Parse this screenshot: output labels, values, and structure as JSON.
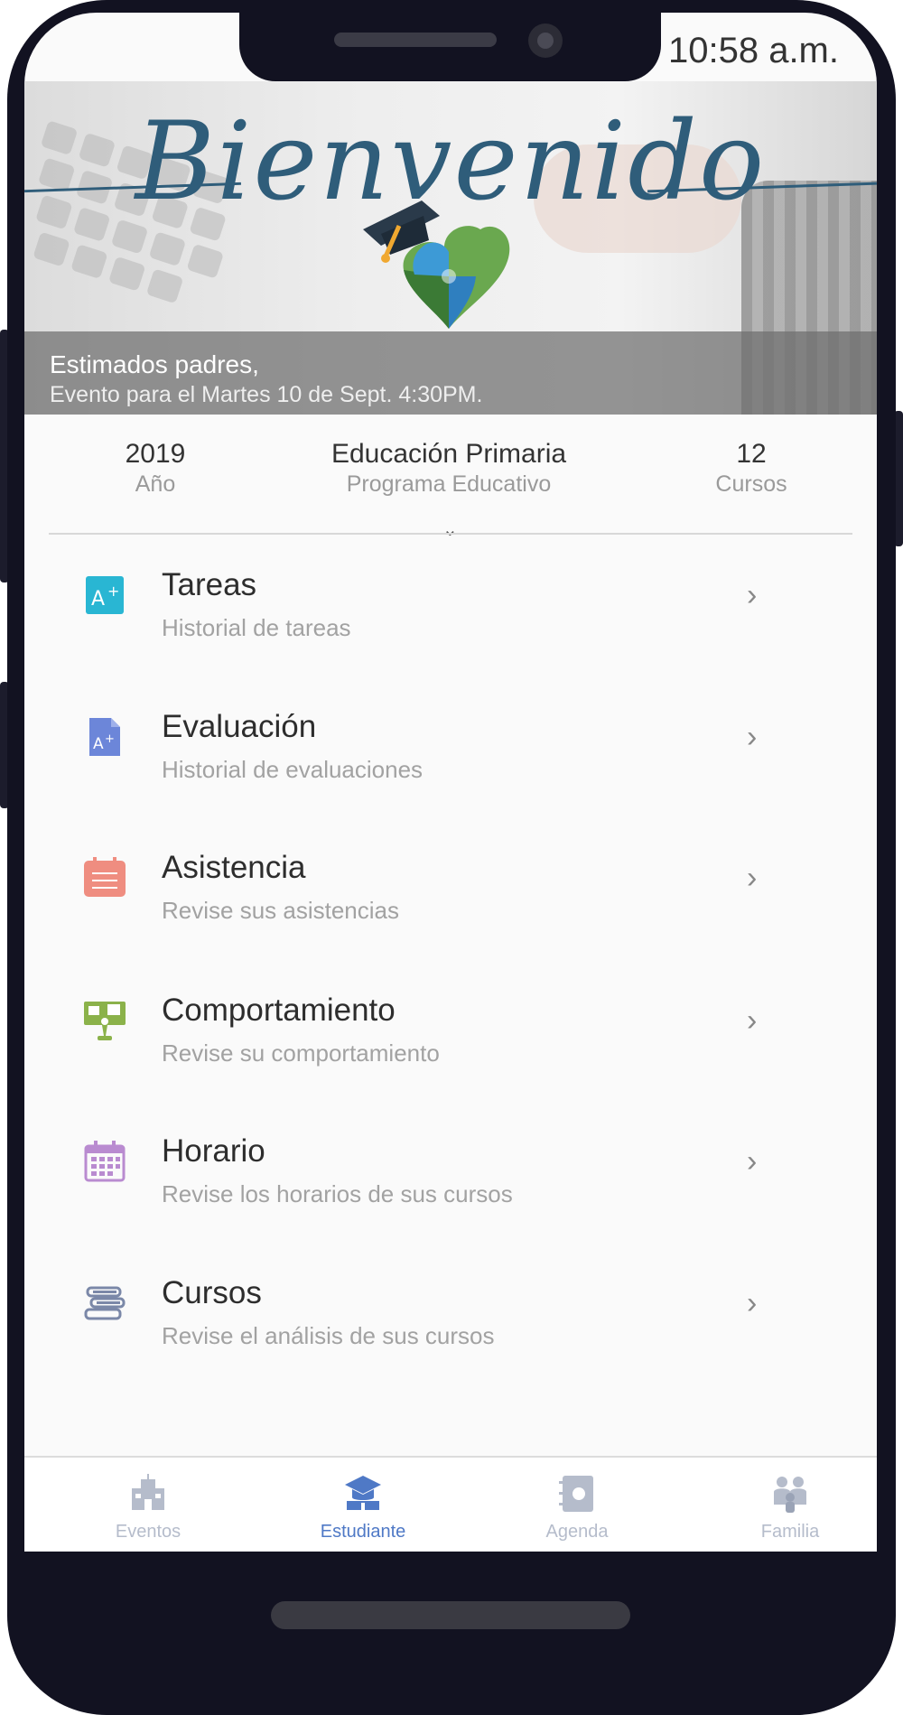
{
  "status_bar": {
    "time": "10:58 a.m."
  },
  "banner": {
    "welcome_text": "Bienvenido",
    "title": "Estimados padres,",
    "subtitle": "Evento para el Martes 10 de Sept. 4:30PM."
  },
  "stats": {
    "year": {
      "value": "2019",
      "label": "Año"
    },
    "program": {
      "value": "Educación Primaria",
      "label": "Programa Educativo"
    },
    "courses": {
      "value": "12",
      "label": "Cursos"
    }
  },
  "menu": [
    {
      "title": "Tareas",
      "subtitle": "Historial de tareas",
      "icon": "grade-a-plus-icon",
      "color": "#29b6d3"
    },
    {
      "title": "Evaluación",
      "subtitle": "Historial de evaluaciones",
      "icon": "evaluation-document-icon",
      "color": "#6c86d9"
    },
    {
      "title": "Asistencia",
      "subtitle": "Revise sus asistencias",
      "icon": "attendance-clipboard-icon",
      "color": "#ef8d80"
    },
    {
      "title": "Comportamiento",
      "subtitle": "Revise su comportamiento",
      "icon": "behavior-board-icon",
      "color": "#8bb24a"
    },
    {
      "title": "Horario",
      "subtitle": "Revise los horarios de sus cursos",
      "icon": "calendar-icon",
      "color": "#b98bd0"
    },
    {
      "title": "Cursos",
      "subtitle": "Revise el análisis de sus cursos",
      "icon": "books-icon",
      "color": "#7b88a8"
    }
  ],
  "bottom_nav": [
    {
      "label": "Eventos",
      "icon": "school-building-icon",
      "active": false
    },
    {
      "label": "Estudiante",
      "icon": "student-cap-icon",
      "active": true
    },
    {
      "label": "Agenda",
      "icon": "agenda-book-icon",
      "active": false
    },
    {
      "label": "Familia",
      "icon": "family-icon",
      "active": false
    }
  ],
  "colors": {
    "accent": "#4f79c6",
    "welcome": "#2f5d7a",
    "inactive_nav": "#b5bccb"
  }
}
